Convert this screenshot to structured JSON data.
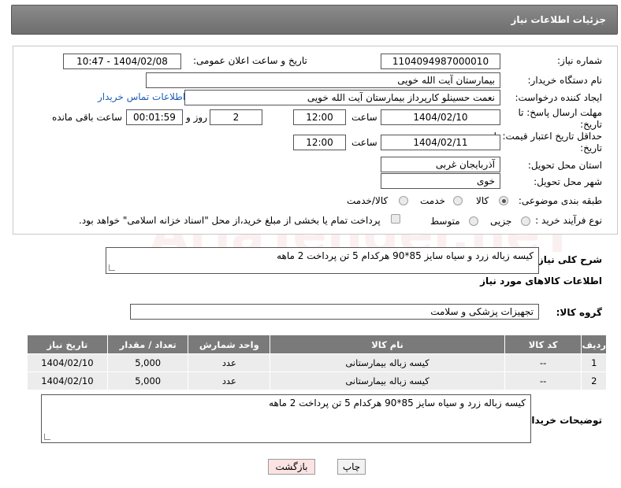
{
  "header": {
    "title": "جزئیات اطلاعات نیاز"
  },
  "form": {
    "need_number_label": "شماره نیاز:",
    "need_number": "1104094987000010",
    "announce_label": "تاریخ و ساعت اعلان عمومی:",
    "announce_value": "1404/02/08 - 10:47",
    "buyer_label": "نام دستگاه خریدار:",
    "buyer_value": "بیمارستان آیت الله خویی",
    "creator_label": "ایجاد کننده درخواست:",
    "creator_value": "نعمت حسینلو کارپرداز بیمارستان آیت الله خویی",
    "contact_link": "اطلاعات تماس خریدار",
    "reply_deadline_label": "مهلت ارسال پاسخ: تا تاریخ:",
    "reply_date": "1404/02/10",
    "time_label": "ساعت",
    "reply_time": "12:00",
    "days_value": "2",
    "days_label": "روز و",
    "remaining_time": "00:01:59",
    "remaining_label": "ساعت باقی مانده",
    "price_deadline_label": "حداقل تاریخ اعتبار قیمت: تا تاریخ:",
    "price_date": "1404/02/11",
    "price_time": "12:00",
    "province_label": "استان محل تحویل:",
    "province_value": "آذربایجان غربی",
    "city_label": "شهر محل تحویل:",
    "city_value": "خوی",
    "category_label": "طبقه بندی موضوعی:",
    "category_options": [
      "کالا",
      "خدمت",
      "کالا/خدمت"
    ],
    "category_selected": "کالا",
    "process_label": "نوع فرآیند خرید :",
    "process_options": [
      "جزیی",
      "متوسط"
    ],
    "payment_note": "پرداخت تمام یا بخشی از مبلغ خرید،از محل \"اسناد خزانه اسلامی\" خواهد بود."
  },
  "description": {
    "label": "شرح کلی نیاز:",
    "value": "کیسه زباله زرد و سیاه  سایز 85*90   هرکدام 5 تن  پرداخت 2 ماهه"
  },
  "goods_section": {
    "title": "اطلاعات کالاهای مورد نیاز",
    "group_label": "گروه کالا:",
    "group_value": "تجهیزات پزشکی و سلامت"
  },
  "table": {
    "headers": [
      "ردیف",
      "کد کالا",
      "نام کالا",
      "واحد شمارش",
      "تعداد / مقدار",
      "تاریخ نیاز"
    ],
    "rows": [
      [
        "1",
        "--",
        "کیسه زباله بیمارستانی",
        "عدد",
        "5,000",
        "1404/02/10"
      ],
      [
        "2",
        "--",
        "کیسه زباله بیمارستانی",
        "عدد",
        "5,000",
        "1404/02/10"
      ]
    ]
  },
  "buyer_notes": {
    "label": "توضیحات خریدار:",
    "value": "کیسه زباله زرد و سیاه  سایز 85*90   هرکدام 5 تن  پرداخت 2 ماهه"
  },
  "buttons": {
    "print": "چاپ",
    "back": "بازگشت"
  },
  "watermark": "AriaTender.neT"
}
